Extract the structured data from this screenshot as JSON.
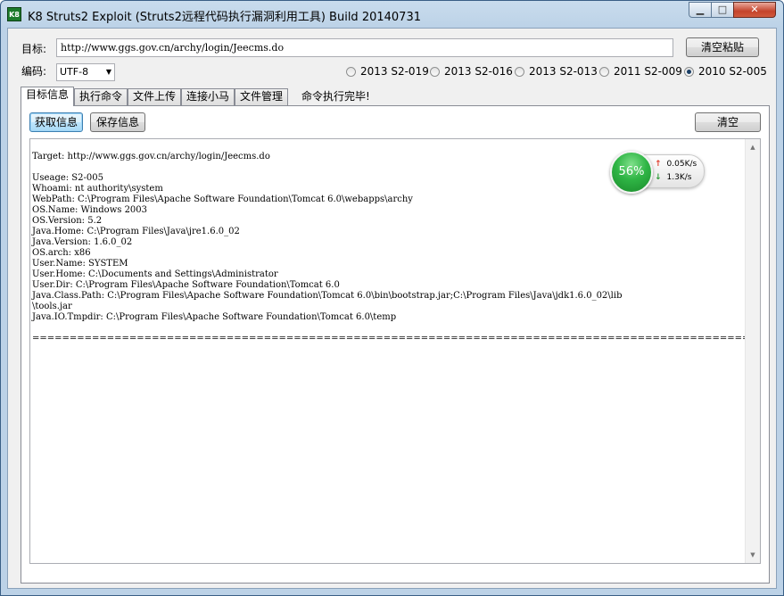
{
  "window": {
    "icon_text": "K8",
    "title": "K8 Struts2 Exploit (Struts2远程代码执行漏洞利用工具)  Build 20140731",
    "min_symbol": "▁",
    "max_symbol": "□",
    "close_symbol": "✕"
  },
  "target": {
    "label": "目标:",
    "url": "http://www.ggs.gov.cn/archy/login/Jeecms.do",
    "clear_paste_label": "清空粘贴"
  },
  "encoding": {
    "label": "编码:",
    "selected": "UTF-8",
    "arrow": "▼"
  },
  "exploits": [
    {
      "label": "2013 S2-019",
      "selected": false
    },
    {
      "label": "2013 S2-016",
      "selected": false
    },
    {
      "label": "2013 S2-013",
      "selected": false
    },
    {
      "label": "2011 S2-009",
      "selected": false
    },
    {
      "label": "2010 S2-005",
      "selected": true
    }
  ],
  "tabs": [
    {
      "label": "目标信息",
      "active": true
    },
    {
      "label": "执行命令",
      "active": false
    },
    {
      "label": "文件上传",
      "active": false
    },
    {
      "label": "连接小马",
      "active": false
    },
    {
      "label": "文件管理",
      "active": false
    }
  ],
  "status_message": "命令执行完毕!",
  "panel": {
    "get_info_label": "获取信息",
    "save_info_label": "保存信息",
    "clear_label": "清空",
    "output": "Target: http://www.ggs.gov.cn/archy/login/Jeecms.do\n\nUseage: S2-005\nWhoami: nt authority\\system\nWebPath: C:\\Program Files\\Apache Software Foundation\\Tomcat 6.0\\webapps\\archy\nOS.Name: Windows 2003\nOS.Version: 5.2\nJava.Home: C:\\Program Files\\Java\\jre1.6.0_02\nJava.Version: 1.6.0_02\nOS.arch: x86\nUser.Name: SYSTEM\nUser.Home: C:\\Documents and Settings\\Administrator\nUser.Dir: C:\\Program Files\\Apache Software Foundation\\Tomcat 6.0\nJava.Class.Path: C:\\Program Files\\Apache Software Foundation\\Tomcat 6.0\\bin\\bootstrap.jar;C:\\Program Files\\Java\\jdk1.6.0_02\\lib\n\\tools.jar\nJava.IO.Tmpdir: C:\\Program Files\\Apache Software Foundation\\Tomcat 6.0\\temp\n\n====================================================================================================================================="
  },
  "speed_widget": {
    "percent": "56%",
    "upload": "0.05K/s",
    "download": "1.3K/s",
    "up_arrow": "↑",
    "down_arrow": "↓"
  },
  "scrollbar": {
    "up_symbol": "▲",
    "down_symbol": "▼"
  }
}
